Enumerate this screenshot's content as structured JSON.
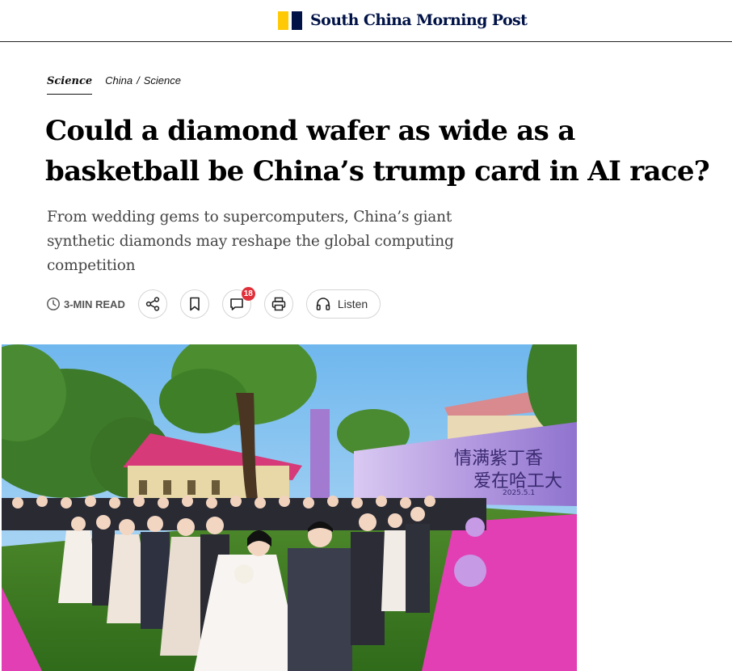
{
  "masthead": {
    "brand": "South China Morning Post",
    "colors": {
      "yellow": "#ffca05",
      "navy": "#001246"
    }
  },
  "breadcrumbs": {
    "primary": "Science",
    "secondary": [
      "China",
      "/",
      "Science"
    ]
  },
  "article": {
    "headline": "Could a diamond wafer as wide as a basketball be China’s trump card in AI race?",
    "summary": "From wedding gems to supercomputers, China’s giant synthetic diamonds may reshape the global computing competition"
  },
  "toolbar": {
    "read_time": "3-MIN READ",
    "comment_count": "18",
    "listen_label": "Listen",
    "icons": [
      "clock-icon",
      "share-icon",
      "bookmark-icon",
      "comment-icon",
      "print-icon",
      "headphones-icon"
    ]
  },
  "hero_image": {
    "description_icon": "photo-wedding-ceremony",
    "banner_text": [
      "情满紫丁香",
      "爱在哈工大"
    ],
    "banner_date": "2025.5.1"
  }
}
